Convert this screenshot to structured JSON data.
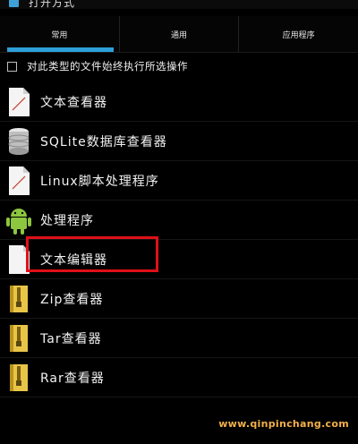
{
  "window": {
    "title": "打开方式"
  },
  "tabs": [
    {
      "label": "常用"
    },
    {
      "label": "通用"
    },
    {
      "label": "应用程序"
    }
  ],
  "checkbox": {
    "label": "对此类型的文件始终执行所选操作",
    "checked": false
  },
  "items": [
    {
      "label": "文本查看器",
      "icon": "document-icon"
    },
    {
      "label": "SQLite数据库查看器",
      "icon": "database-icon"
    },
    {
      "label": "Linux脚本处理程序",
      "icon": "document-icon"
    },
    {
      "label": "处理程序",
      "icon": "android-icon"
    },
    {
      "label": "文本编辑器",
      "icon": "document-icon"
    },
    {
      "label": "Zip查看器",
      "icon": "archive-icon"
    },
    {
      "label": "Tar查看器",
      "icon": "archive-icon"
    },
    {
      "label": "Rar查看器",
      "icon": "archive-icon"
    }
  ],
  "colors": {
    "accent": "#2e9fd8",
    "highlight": "#e01018",
    "watermark": "#f3b04a"
  },
  "watermark": "www.qinpinchang.com"
}
